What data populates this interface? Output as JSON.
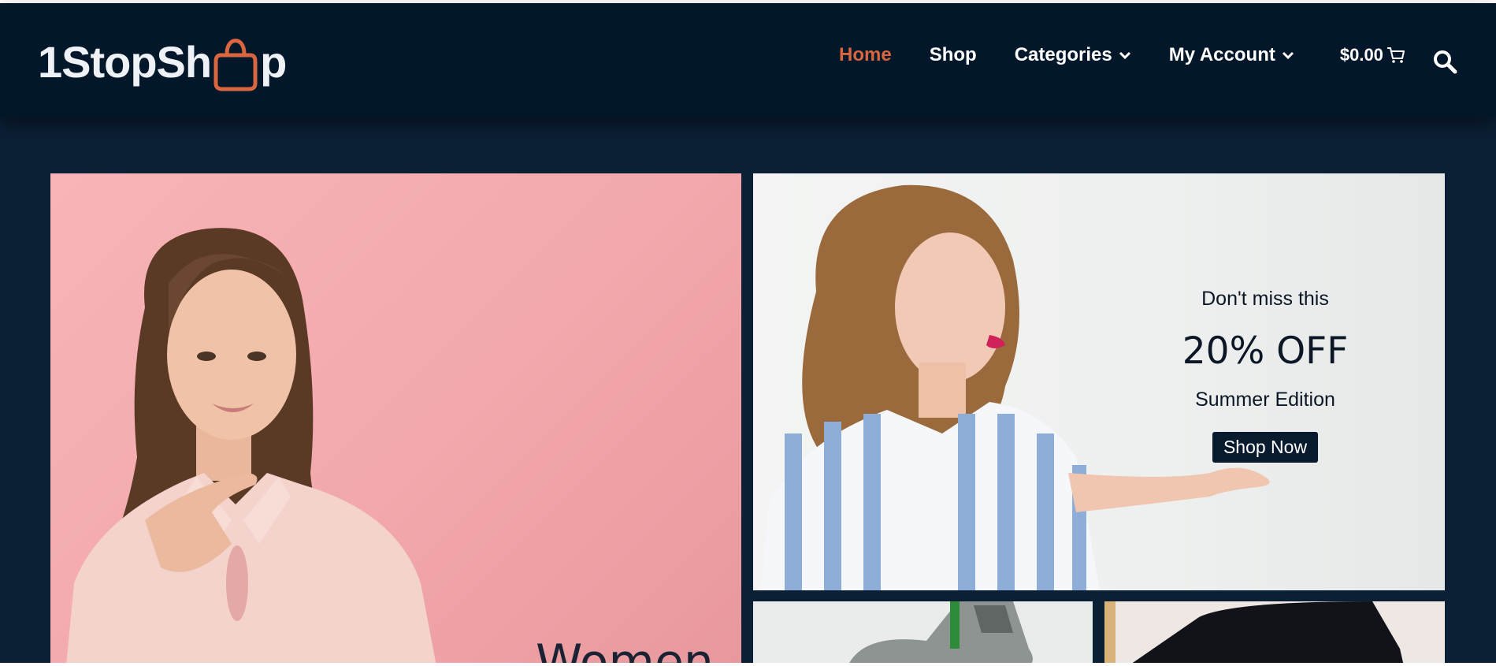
{
  "brand": {
    "logo_before": "1StopSh",
    "logo_after": "p"
  },
  "nav": {
    "home": "Home",
    "shop": "Shop",
    "categories": "Categories",
    "account": "My Account",
    "cart_total": "$0.00",
    "icons": {
      "categories_toggle": "chevron-down-icon",
      "account_toggle": "chevron-down-icon",
      "cart": "cart-icon",
      "search": "search-icon"
    }
  },
  "hero": {
    "women_title": "Women",
    "promo": {
      "eyebrow": "Don't miss this",
      "discount": "20% OFF",
      "edition": "Summer Edition",
      "cta": "Shop Now"
    }
  },
  "colors": {
    "header_bg": "#03172b",
    "page_bg": "#0b1f35",
    "accent": "#d8663e",
    "button_bg": "#071a2e",
    "women_panel": "#f4aeb2"
  }
}
